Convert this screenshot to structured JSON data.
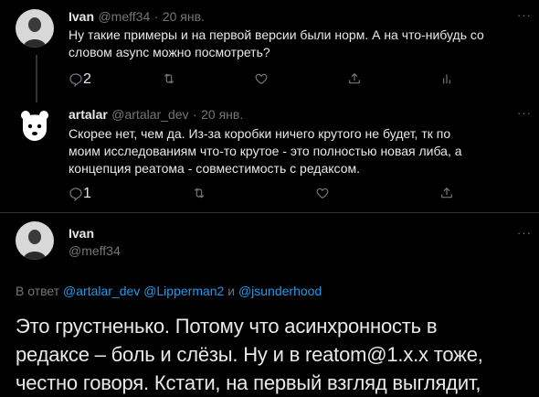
{
  "tweet1": {
    "name": "Ivan",
    "handle": "@meff34",
    "sep": "·",
    "date": "20 янв.",
    "more": "···",
    "text_line1": "Ну такие примеры и на первой версии были норм. А на что-нибудь со",
    "text_line2": "словом async можно посмотреть?",
    "reply_count": "2",
    "icons": [
      "reply-icon",
      "retweet-icon",
      "like-icon",
      "share-icon",
      "analytics-icon"
    ]
  },
  "tweet2": {
    "name": "artalar",
    "handle": "@artalar_dev",
    "sep": "·",
    "date": "20 янв.",
    "more": "···",
    "text_line1": "Скорее нет, чем да. Из-за коробки ничего крутого не будет, тк по",
    "text_line2": "моим исследованиям что-то крутое - это полностью новая либа, а",
    "text_line3": "концепция реатома - совместимость с редаксом.",
    "reply_count": "1",
    "icons": [
      "reply-icon",
      "retweet-icon",
      "like-icon",
      "share-icon"
    ]
  },
  "main": {
    "name": "Ivan",
    "handle": "@meff34",
    "more": "···",
    "reply_prefix": "В ответ",
    "mention1": "@artalar_dev",
    "mention2": "@Lipperman2",
    "and": "и",
    "mention3": "@jsunderhood",
    "text_line1": "Это грустненько. Потому что асинхронность в",
    "text_line2": "редаксе – боль и слёзы. Ну и в reatom@1.x.x тоже,",
    "text_line3": "честно говоря. Кстати, на первый взгляд выглядит,"
  },
  "colors": {
    "bg": "#000000",
    "text": "#e7e9ea",
    "muted": "#71767b",
    "link": "#1d9bf0",
    "line": "#333639"
  }
}
